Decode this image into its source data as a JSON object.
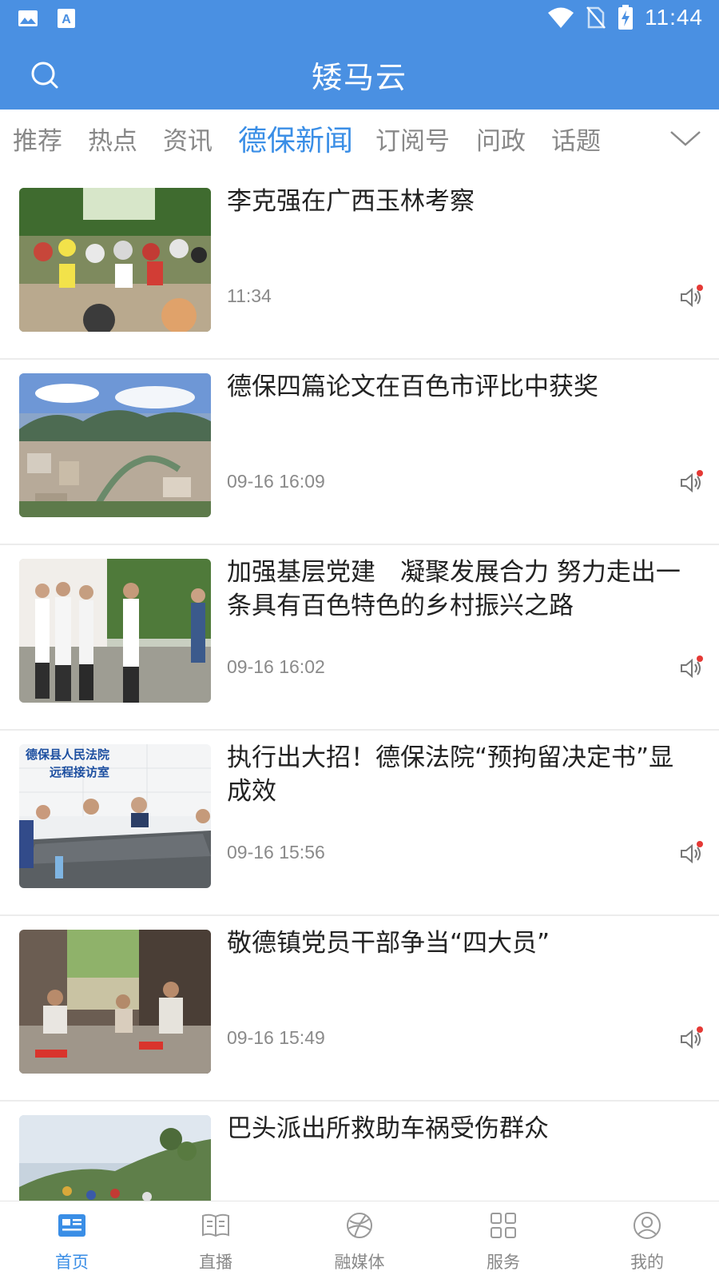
{
  "status": {
    "time": "11:44",
    "icons": [
      "gallery-icon",
      "a-icon",
      "wifi-icon",
      "no-sim-icon",
      "battery-charging-icon"
    ]
  },
  "header": {
    "title": "矮马云",
    "search_icon": "search-icon"
  },
  "tabs": [
    {
      "label": "推荐",
      "active": false
    },
    {
      "label": "热点",
      "active": false
    },
    {
      "label": "资讯",
      "active": false
    },
    {
      "label": "德保新闻",
      "active": true
    },
    {
      "label": "订阅号",
      "active": false
    },
    {
      "label": "问政",
      "active": false
    },
    {
      "label": "话题",
      "active": false
    }
  ],
  "news": [
    {
      "title": " 李克强在广西玉林考察",
      "time": "11:34"
    },
    {
      "title": "德保四篇论文在百色市评比中获奖",
      "time": "09-16 16:09"
    },
    {
      "title": "加强基层党建　凝聚发展合力 努力走出一条具有百色特色的乡村振兴之路",
      "time": "09-16 16:02"
    },
    {
      "title": "执行出大招！德保法院“预拘留决定书”显成效",
      "time": "09-16 15:56"
    },
    {
      "title": "敬德镇党员干部争当“四大员”",
      "time": "09-16 15:49"
    },
    {
      "title": "巴头派出所救助车祸受伤群众",
      "time": ""
    }
  ],
  "thumb_text": {
    "court_sign": "德保县人民法院",
    "court_sub": "远程接访室"
  },
  "bottom_nav": [
    {
      "label": "首页",
      "icon": "news-icon",
      "active": true
    },
    {
      "label": "直播",
      "icon": "book-icon",
      "active": false
    },
    {
      "label": "融媒体",
      "icon": "globe-icon",
      "active": false
    },
    {
      "label": "服务",
      "icon": "grid-icon",
      "active": false
    },
    {
      "label": "我的",
      "icon": "user-icon",
      "active": false
    }
  ],
  "colors": {
    "primary": "#4a90e2",
    "active_tab": "#3a8ee6",
    "inactive_text": "#888888",
    "badge_red": "#e53935"
  }
}
